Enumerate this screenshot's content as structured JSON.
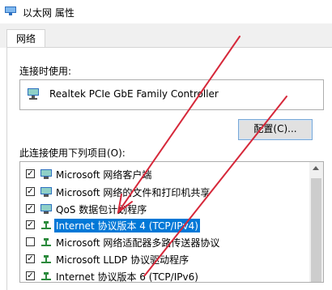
{
  "window": {
    "title": "以太网 属性"
  },
  "tabs": [
    {
      "label": "网络"
    }
  ],
  "connect_using": {
    "label": "连接时使用:",
    "adapter": "Realtek PCIe GbE Family Controller",
    "configure_button": "配置(C)..."
  },
  "items_section": {
    "label": "此连接使用下列项目(O):",
    "items": [
      {
        "label": "Microsoft 网络客户端",
        "checked": true,
        "icon": "network-client-icon"
      },
      {
        "label": "Microsoft 网络的文件和打印机共享",
        "checked": true,
        "icon": "file-printer-sharing-icon"
      },
      {
        "label": "QoS 数据包计划程序",
        "checked": true,
        "icon": "qos-scheduler-icon"
      },
      {
        "label": "Internet 协议版本 4 (TCP/IPv4)",
        "checked": true,
        "selected": true,
        "icon": "protocol-icon"
      },
      {
        "label": "Microsoft 网络适配器多路传送器协议",
        "checked": false,
        "icon": "protocol-icon"
      },
      {
        "label": "Microsoft LLDP 协议驱动程序",
        "checked": true,
        "icon": "protocol-icon"
      },
      {
        "label": "Internet 协议版本 6 (TCP/IPv6)",
        "checked": true,
        "icon": "protocol-icon"
      }
    ]
  },
  "colors": {
    "selection": "#0078d7",
    "annotation_arrow": "#d6283a"
  }
}
